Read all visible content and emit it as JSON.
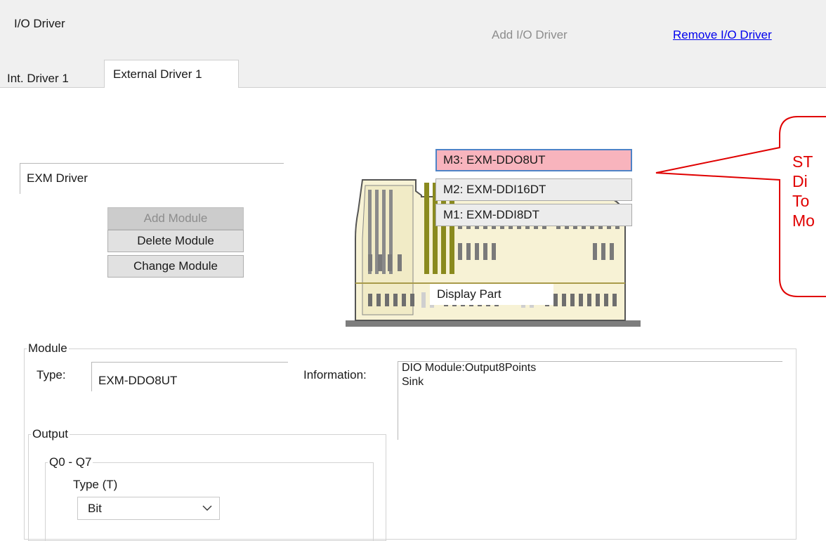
{
  "window": {
    "title": "I/O Driver"
  },
  "header": {
    "add_driver_label": "Add I/O Driver",
    "remove_driver_label": "Remove I/O Driver"
  },
  "tabs": [
    {
      "label": "Int. Driver 1",
      "active": false
    },
    {
      "label": "External Driver 1",
      "active": true
    }
  ],
  "driver": {
    "name": "EXM Driver"
  },
  "buttons": {
    "add_module": "Add Module",
    "delete_module": "Delete Module",
    "change_module": "Change Module"
  },
  "module_list": [
    {
      "label": "M3: EXM-DDO8UT",
      "selected": true
    },
    {
      "label": "M2: EXM-DDI16DT",
      "selected": false
    },
    {
      "label": "M1: EXM-DDI8DT",
      "selected": false
    }
  ],
  "device": {
    "display_part_label": "Display Part"
  },
  "callout": {
    "lines": [
      "ST",
      "Di",
      "To",
      "Mo"
    ]
  },
  "module_group": {
    "title": "Module",
    "type_label": "Type:",
    "type_value": "EXM-DDO8UT",
    "info_label": "Information:",
    "info_text": "DIO Module:Output8Points\nSink"
  },
  "output_group": {
    "title": "Output",
    "range_title": "Q0 - Q7",
    "type_label": "Type (T)",
    "type_value": "Bit"
  },
  "colors": {
    "selected_module_bg": "#f8b4bd",
    "selected_module_border": "#4e83c7",
    "callout_red": "#e00000",
    "link_blue": "#0000ee",
    "device_body": "#f7f2d5"
  }
}
